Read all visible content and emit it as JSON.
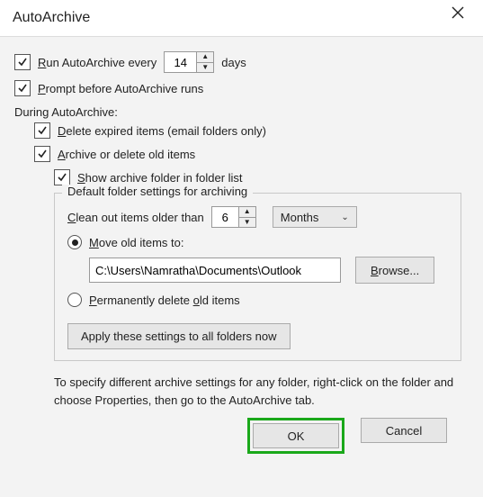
{
  "window": {
    "title": "AutoArchive"
  },
  "options": {
    "run_every_pre": "R",
    "run_every_post": "un AutoArchive every",
    "run_every_value": "14",
    "run_every_unit": "days",
    "prompt_pre": "P",
    "prompt_post": "rompt before AutoArchive runs",
    "during_label": "During AutoArchive:",
    "delete_expired_pre": "D",
    "delete_expired_post": "elete expired items (email folders only)",
    "archive_delete_pre": "A",
    "archive_delete_post": "rchive or delete old items",
    "show_folder_pre": "S",
    "show_folder_post": "how archive folder in folder list"
  },
  "group": {
    "legend": "Default folder settings for archiving",
    "clean_pre": "C",
    "clean_post": "lean out items older than",
    "clean_value": "6",
    "clean_unit": "Months",
    "move_pre": "M",
    "move_post": "ove old items to:",
    "path_value": "C:\\Users\\Namratha\\Documents\\Outlook",
    "browse_pre": "B",
    "browse_post": "rowse...",
    "perm_pre": "P",
    "perm_mid": "ermanently delete ",
    "perm_u2": "o",
    "perm_post": "ld items",
    "apply_label": "Apply these settings to all folders now"
  },
  "hint": "To specify different archive settings for any folder, right-click on the folder and choose Properties, then go to the AutoArchive tab.",
  "buttons": {
    "ok": "OK",
    "cancel": "Cancel"
  }
}
